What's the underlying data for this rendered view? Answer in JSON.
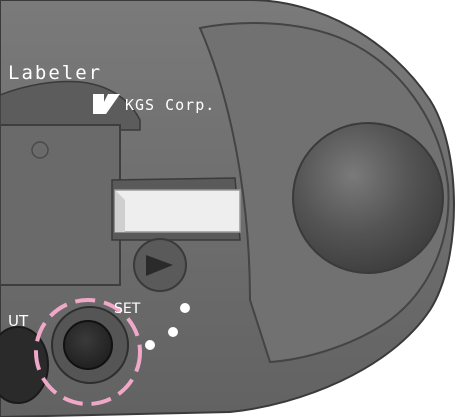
{
  "device": {
    "brand_text": "Labeler",
    "company_name": "KGS Corp.",
    "cut_button_label": "UT",
    "set_button_label": "SET"
  },
  "colors": {
    "body": "#6e6e6e",
    "body_dark": "#4a4a4a",
    "highlight_ring": "#f0a8c8",
    "label_text": "#ffffff",
    "tape": "#eeeeee"
  },
  "icons": {
    "logo": "kgs-logo-icon",
    "feed": "play-arrow-icon",
    "indicator_leds": "led-dots-icon"
  }
}
